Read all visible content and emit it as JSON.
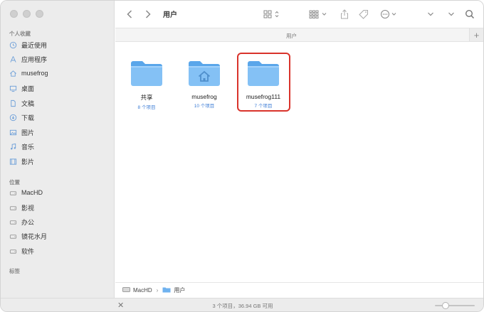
{
  "toolbar": {
    "title": "用户"
  },
  "sidebar": {
    "favorites_header": "个人收藏",
    "favorites": [
      {
        "label": "最近使用",
        "icon": "clock-icon"
      },
      {
        "label": "应用程序",
        "icon": "applications-icon"
      },
      {
        "label": "musefrog",
        "icon": "home-icon"
      },
      {
        "label": "桌面",
        "icon": "desktop-icon"
      },
      {
        "label": "文稿",
        "icon": "document-icon"
      },
      {
        "label": "下载",
        "icon": "download-icon"
      },
      {
        "label": "图片",
        "icon": "photo-icon"
      },
      {
        "label": "音乐",
        "icon": "music-icon"
      },
      {
        "label": "影片",
        "icon": "film-icon"
      }
    ],
    "locations_header": "位置",
    "locations": [
      {
        "label": "MacHD",
        "icon": "disk-icon"
      },
      {
        "label": "影视",
        "icon": "disk-icon"
      },
      {
        "label": "办公",
        "icon": "disk-icon"
      },
      {
        "label": "镜花水月",
        "icon": "disk-icon"
      },
      {
        "label": "软件",
        "icon": "disk-icon"
      }
    ],
    "tags_header": "标签"
  },
  "header_bar": {
    "label": "用户",
    "plus": "+"
  },
  "folders": [
    {
      "name": "共享",
      "count": "8 个项目",
      "icon": "folder-icon"
    },
    {
      "name": "musefrog",
      "count": "10 个项目",
      "icon": "home-folder-icon"
    },
    {
      "name": "musefrog111",
      "count": "7 个项目",
      "icon": "folder-icon",
      "highlighted": true
    }
  ],
  "pathbar": {
    "root": "MacHD",
    "separator": "›",
    "current": "用户"
  },
  "status": {
    "text": "3 个项目，36.94 GB 可用",
    "close": "✕"
  },
  "colors": {
    "folder": "#7fbdf2",
    "highlight": "#d9332b",
    "link": "#3a7bd5"
  }
}
